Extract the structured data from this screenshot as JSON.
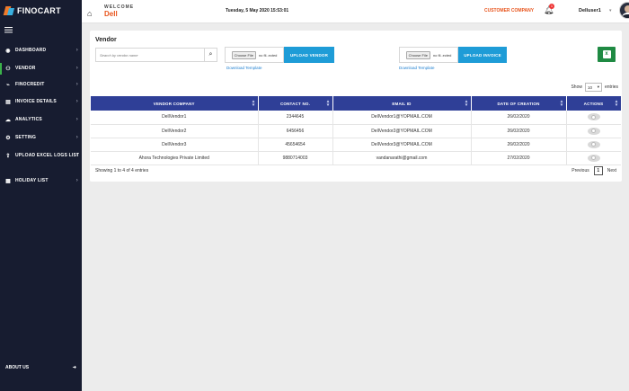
{
  "app": {
    "brand": "FINOCART"
  },
  "sidebar": {
    "items": [
      {
        "label": "DASHBOARD",
        "icon": "dashboard-icon"
      },
      {
        "label": "VENDOR",
        "icon": "vendor-icon",
        "active": true
      },
      {
        "label": "FINOCREDIT",
        "icon": "finocredit-icon"
      },
      {
        "label": "INVOICE DETAILS",
        "icon": "invoice-icon"
      },
      {
        "label": "ANALYTICS",
        "icon": "analytics-icon"
      },
      {
        "label": "SETTING",
        "icon": "gear-icon"
      },
      {
        "label": "UPLOAD EXCEL LOGS LIST",
        "icon": "upload-logs-icon"
      },
      {
        "label": "HOLIDAY LIST",
        "icon": "holiday-icon"
      }
    ],
    "footer_label": "ABOUT US"
  },
  "header": {
    "welcome": "WELCOME",
    "name": "Dell",
    "datetime": "Tuesday, 5 May 2020 15:53:01",
    "company": "CUSTOMER COMPANY",
    "notification_count": "1",
    "username": "Delluser1"
  },
  "vendor": {
    "title": "Vendor",
    "search_placeholder": "Search by vendor name",
    "choose_file": "Choose File",
    "no_file": "no fil..ected",
    "upload_vendor": "UPLOAD VENDOR",
    "upload_invoice": "UPLOAD INVOICE",
    "download_template": "Download Template",
    "show_label": "Show",
    "entries_value": "10",
    "entries_label": "entries",
    "columns": [
      "VENDOR COMPANY",
      "CONTACT NO.",
      "EMAIL ID",
      "DATE OF CREATION",
      "ACTIONS"
    ],
    "rows": [
      {
        "company": "DellVendor1",
        "contact": "2344645",
        "email": "DellVendor1@YOPMAIL.COM",
        "date": "26/02/2020"
      },
      {
        "company": "DellVendor2",
        "contact": "6456456",
        "email": "DellVendor2@YOPMAIL.COM",
        "date": "26/02/2020"
      },
      {
        "company": "DellVendor3",
        "contact": "45654654",
        "email": "DellVendor3@YOPMAIL.COM",
        "date": "26/02/2020"
      },
      {
        "company": "Ahora Technologies Private Limited",
        "contact": "9880714003",
        "email": "vandanarathi@gmail.com",
        "date": "27/02/2020"
      }
    ],
    "info": "Showing 1 to 4 of 4 entries",
    "previous": "Previous",
    "page": "1",
    "next": "Next"
  },
  "colors": {
    "sidebar": "#171c30",
    "accent": "#e8541c",
    "table_header": "#2f3f97",
    "upload_button": "#1e9cd7",
    "excel": "#1f8a43"
  }
}
